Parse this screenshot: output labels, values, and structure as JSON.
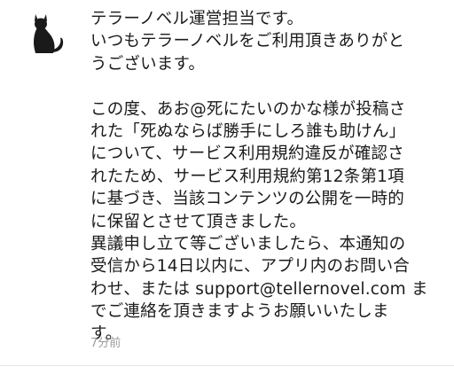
{
  "notification": {
    "avatar_icon": "cat-silhouette-icon",
    "message_lines": [
      "テラーノベル運営担当です。",
      "いつもテラーノベルをご利用頂きありがと",
      "うございます。",
      "",
      "この度、あお@死にたいのかな様が投稿さ",
      "れた「死ぬならば勝手にしろ誰も助けん」",
      "について、サービス利用規約違反が確認さ",
      "れたため、サービス利用規約第12条第1項",
      "に基づき、当該コンテンツの公開を一時的",
      "に保留とさせて頂きました。",
      "異議申し立て等ございましたら、本通知の",
      "受信から14日以内に、アプリ内のお問い合",
      "わせ、または support@tellernovel.com ま",
      "でご連絡を頂きますようお願いいたしま",
      "す。"
    ],
    "timestamp": "7分前"
  }
}
